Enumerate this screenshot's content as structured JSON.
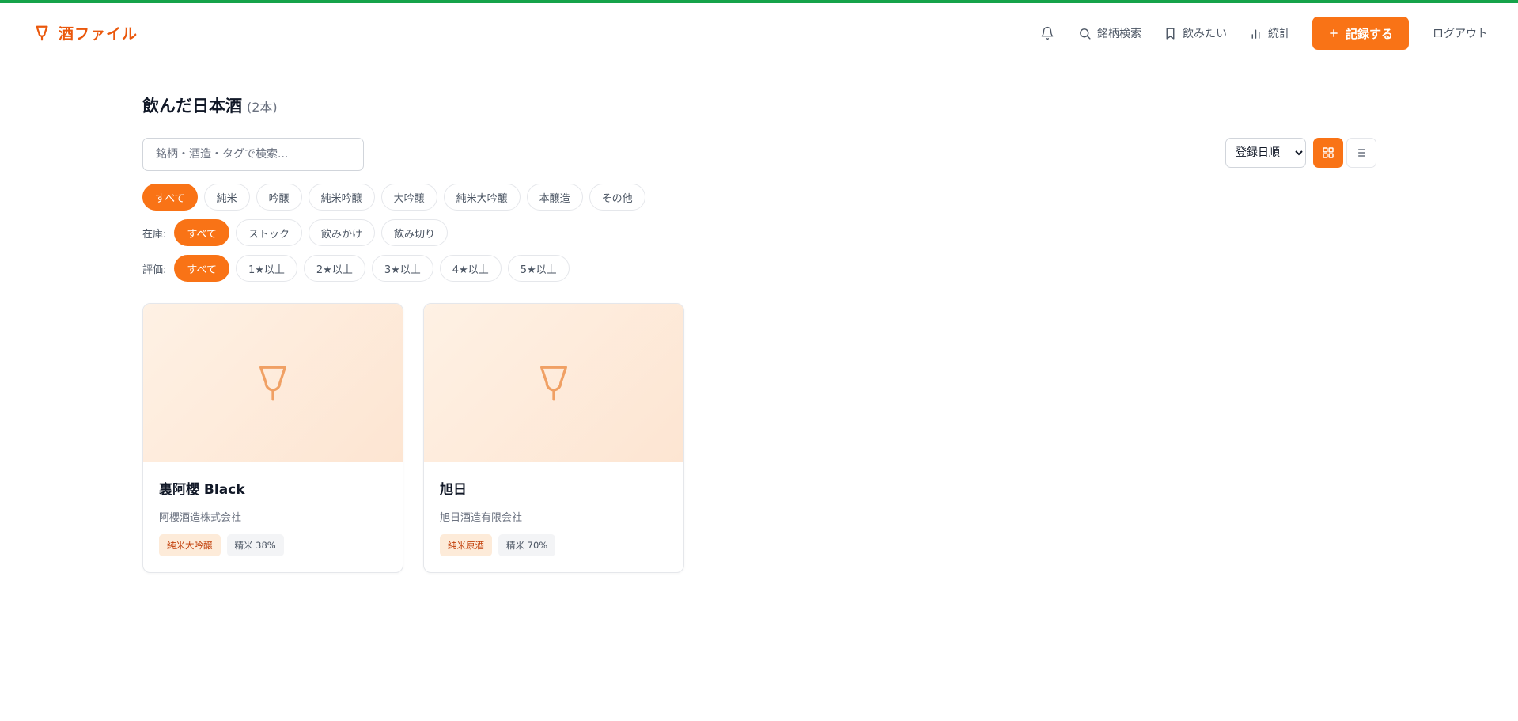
{
  "app": {
    "name": "酒ファイル"
  },
  "nav": {
    "search": "銘柄検索",
    "wishlist": "飲みたい",
    "stats": "統計",
    "record": "記録する",
    "logout": "ログアウト"
  },
  "page": {
    "title": "飲んだ日本酒",
    "count": "(2本)"
  },
  "search": {
    "placeholder": "銘柄・酒造・タグで検索..."
  },
  "sort": {
    "selected": "登録日順"
  },
  "filters": {
    "type": [
      "すべて",
      "純米",
      "吟醸",
      "純米吟醸",
      "大吟醸",
      "純米大吟醸",
      "本醸造",
      "その他"
    ],
    "stock_label": "在庫:",
    "stock": [
      "すべて",
      "ストック",
      "飲みかけ",
      "飲み切り"
    ],
    "rating_label": "評価:",
    "rating": [
      "すべて",
      "1★以上",
      "2★以上",
      "3★以上",
      "4★以上",
      "5★以上"
    ]
  },
  "cards": [
    {
      "name": "裏阿櫻 Black",
      "brewery": "阿櫻酒造株式会社",
      "type": "純米大吟醸",
      "polish": "精米 38%"
    },
    {
      "name": "旭日",
      "brewery": "旭日酒造有限会社",
      "type": "純米原酒",
      "polish": "精米 70%"
    }
  ],
  "colors": {
    "accent": "#f97316",
    "top_bar": "#16a34a",
    "card_image_bg": "#fde9d6"
  }
}
